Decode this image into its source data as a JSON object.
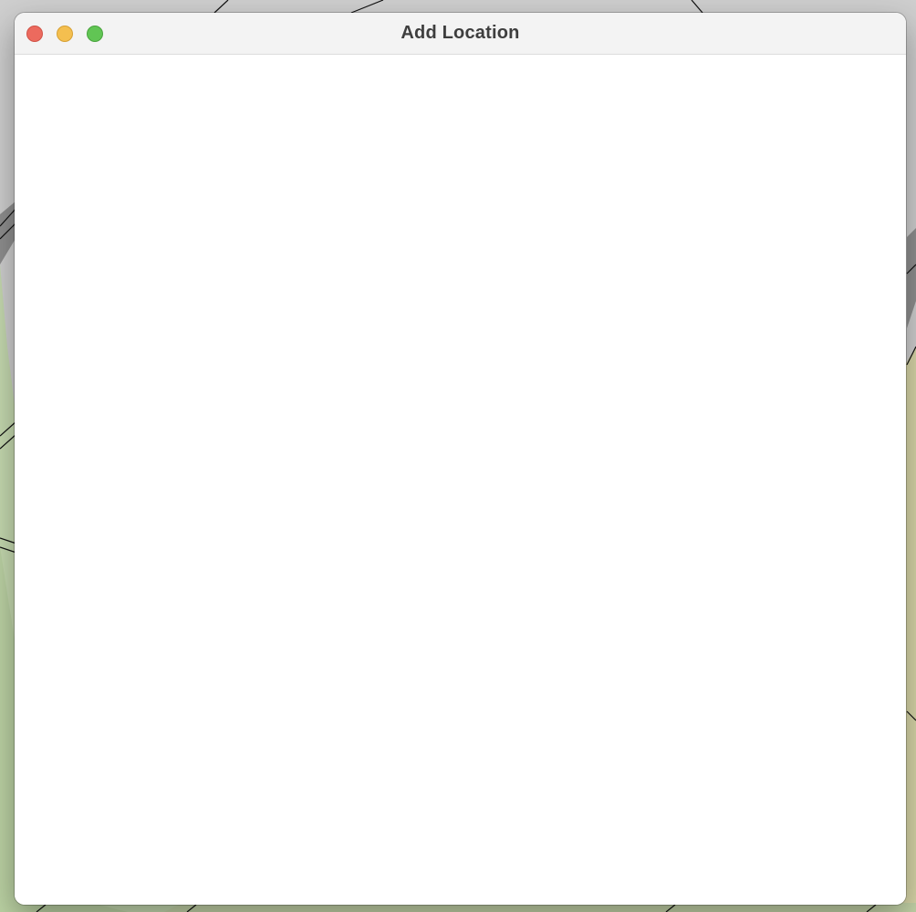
{
  "window": {
    "title": "Add Location",
    "controls": {
      "close": "close",
      "minimize": "minimize",
      "zoom": "zoom"
    },
    "colors": {
      "close": "#ec6a5e",
      "minimize": "#f4bf4f",
      "zoom": "#61c554",
      "titlebar": "#f3f3f3",
      "title_text": "#3e3e3e"
    }
  },
  "desktop": {
    "colors": {
      "map_gray": "#c9c9c9",
      "map_green": "#c6dab0",
      "map_yellow": "#d8d6a8"
    }
  }
}
